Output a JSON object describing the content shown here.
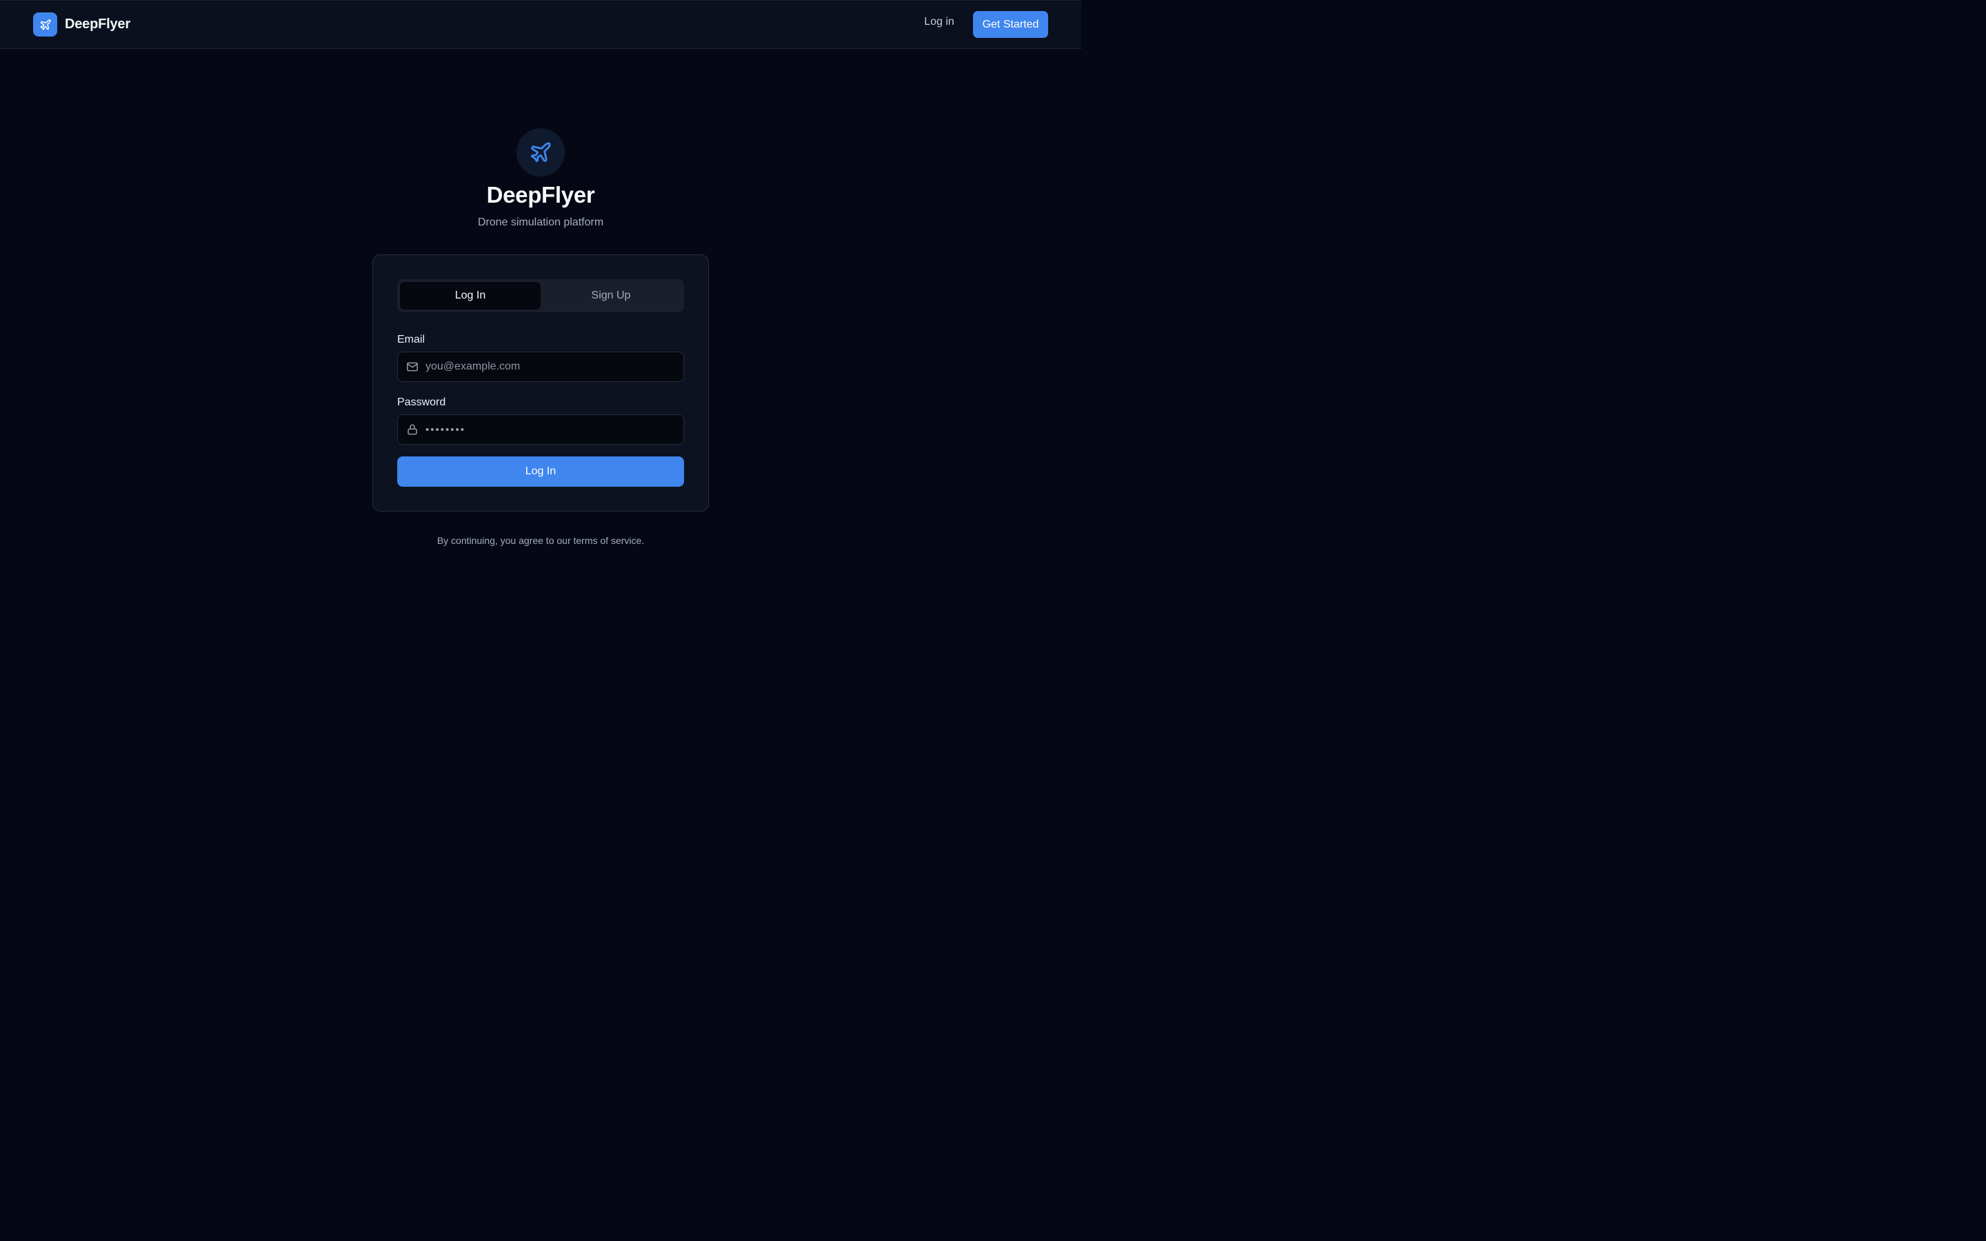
{
  "header": {
    "brand_name": "DeepFlyer",
    "brand_icon": "plane-icon",
    "login_label": "Log in",
    "cta_label": "Get Started"
  },
  "hero": {
    "icon": "plane-icon",
    "title": "DeepFlyer",
    "subtitle": "Drone simulation platform"
  },
  "auth_card": {
    "tabs": [
      {
        "label": "Log In",
        "active": true
      },
      {
        "label": "Sign Up",
        "active": false
      }
    ],
    "email": {
      "label": "Email",
      "icon": "mail-icon",
      "placeholder": "you@example.com",
      "value": ""
    },
    "password": {
      "label": "Password",
      "icon": "lock-icon",
      "value": "••••••••"
    },
    "submit_label": "Log In"
  },
  "footer": {
    "terms_text": "By continuing, you agree to our terms of service."
  },
  "colors": {
    "background": "#050814",
    "accent": "#3f86ee",
    "card": "#0d1220",
    "muted_text": "#a4acb9"
  }
}
